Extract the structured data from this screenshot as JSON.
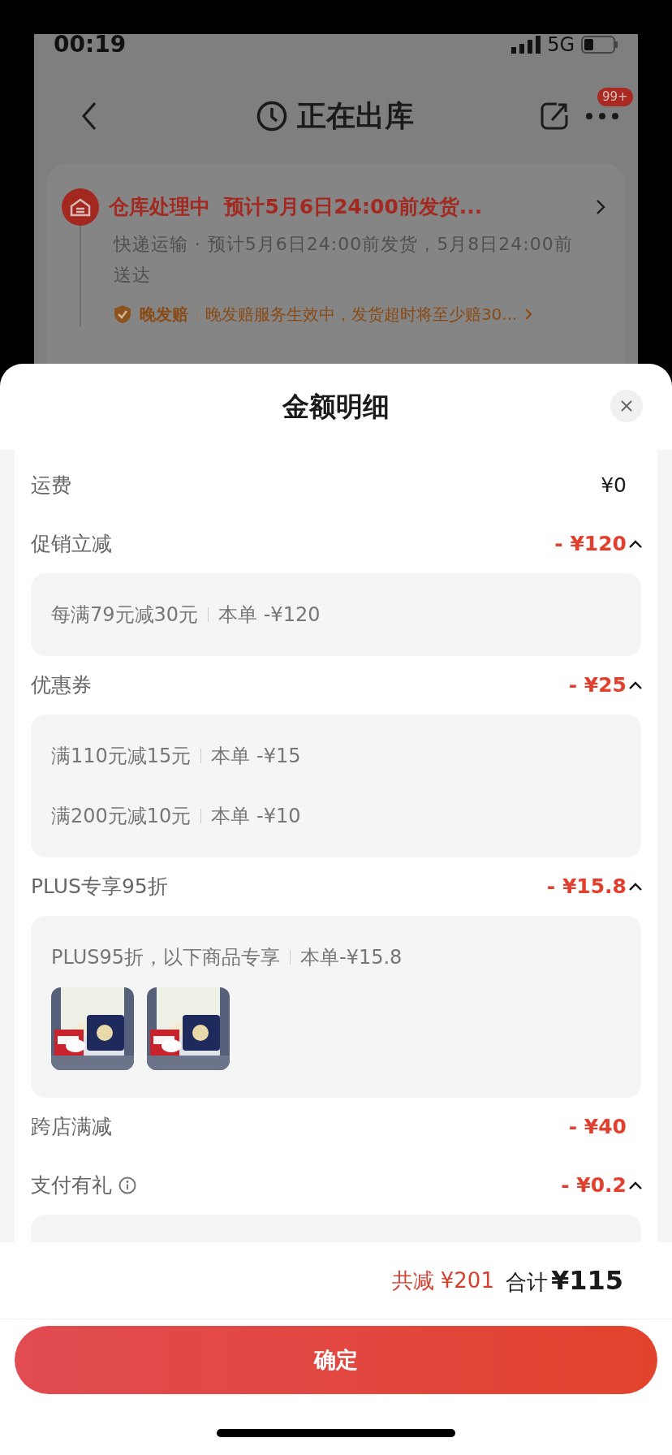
{
  "status_bar": {
    "time": "00:19",
    "network": "5G"
  },
  "nav": {
    "title": "正在出库",
    "badge": "99+"
  },
  "order_card": {
    "title": "仓库处理中  预计5月6日24:00前发货...",
    "subtitle": "快递运输 · 预计5月6日24:00前发货，5月8日24:00前送达",
    "guarantee": {
      "label": "晚发赔",
      "text": "晚发赔服务生效中，发货超时将至少赔30..."
    }
  },
  "sheet": {
    "title": "金额明细",
    "rows": [
      {
        "kind": "fee",
        "label": "运费",
        "amount": "¥0"
      },
      {
        "kind": "discount",
        "label": "促销立减",
        "amount": "- ¥120",
        "expanded": true,
        "lines": [
          {
            "text": "每满79元减30元",
            "amount": "本单 -¥120"
          }
        ]
      },
      {
        "kind": "discount",
        "label": "优惠券",
        "amount": "- ¥25",
        "expanded": true,
        "lines": [
          {
            "text": "满110元减15元",
            "amount": "本单 -¥15"
          },
          {
            "text": "满200元减10元",
            "amount": "本单 -¥10"
          }
        ]
      },
      {
        "kind": "discount",
        "label": "PLUS专享95折",
        "amount": "- ¥15.8",
        "expanded": true,
        "lines": [
          {
            "text": "PLUS95折，以下商品专享",
            "amount": "本单-¥15.8"
          }
        ],
        "products": [
          {
            "kind": "picture"
          },
          {
            "kind": "picture"
          }
        ]
      },
      {
        "kind": "discount",
        "label": "跨店满减",
        "amount": "- ¥40"
      },
      {
        "kind": "discount",
        "label": "支付有礼",
        "amount": "- ¥0.2",
        "info": true,
        "expanded": true
      }
    ],
    "total_saved": "共减 ¥201",
    "total_label": "合计",
    "total": "¥115",
    "confirm": "确定"
  }
}
